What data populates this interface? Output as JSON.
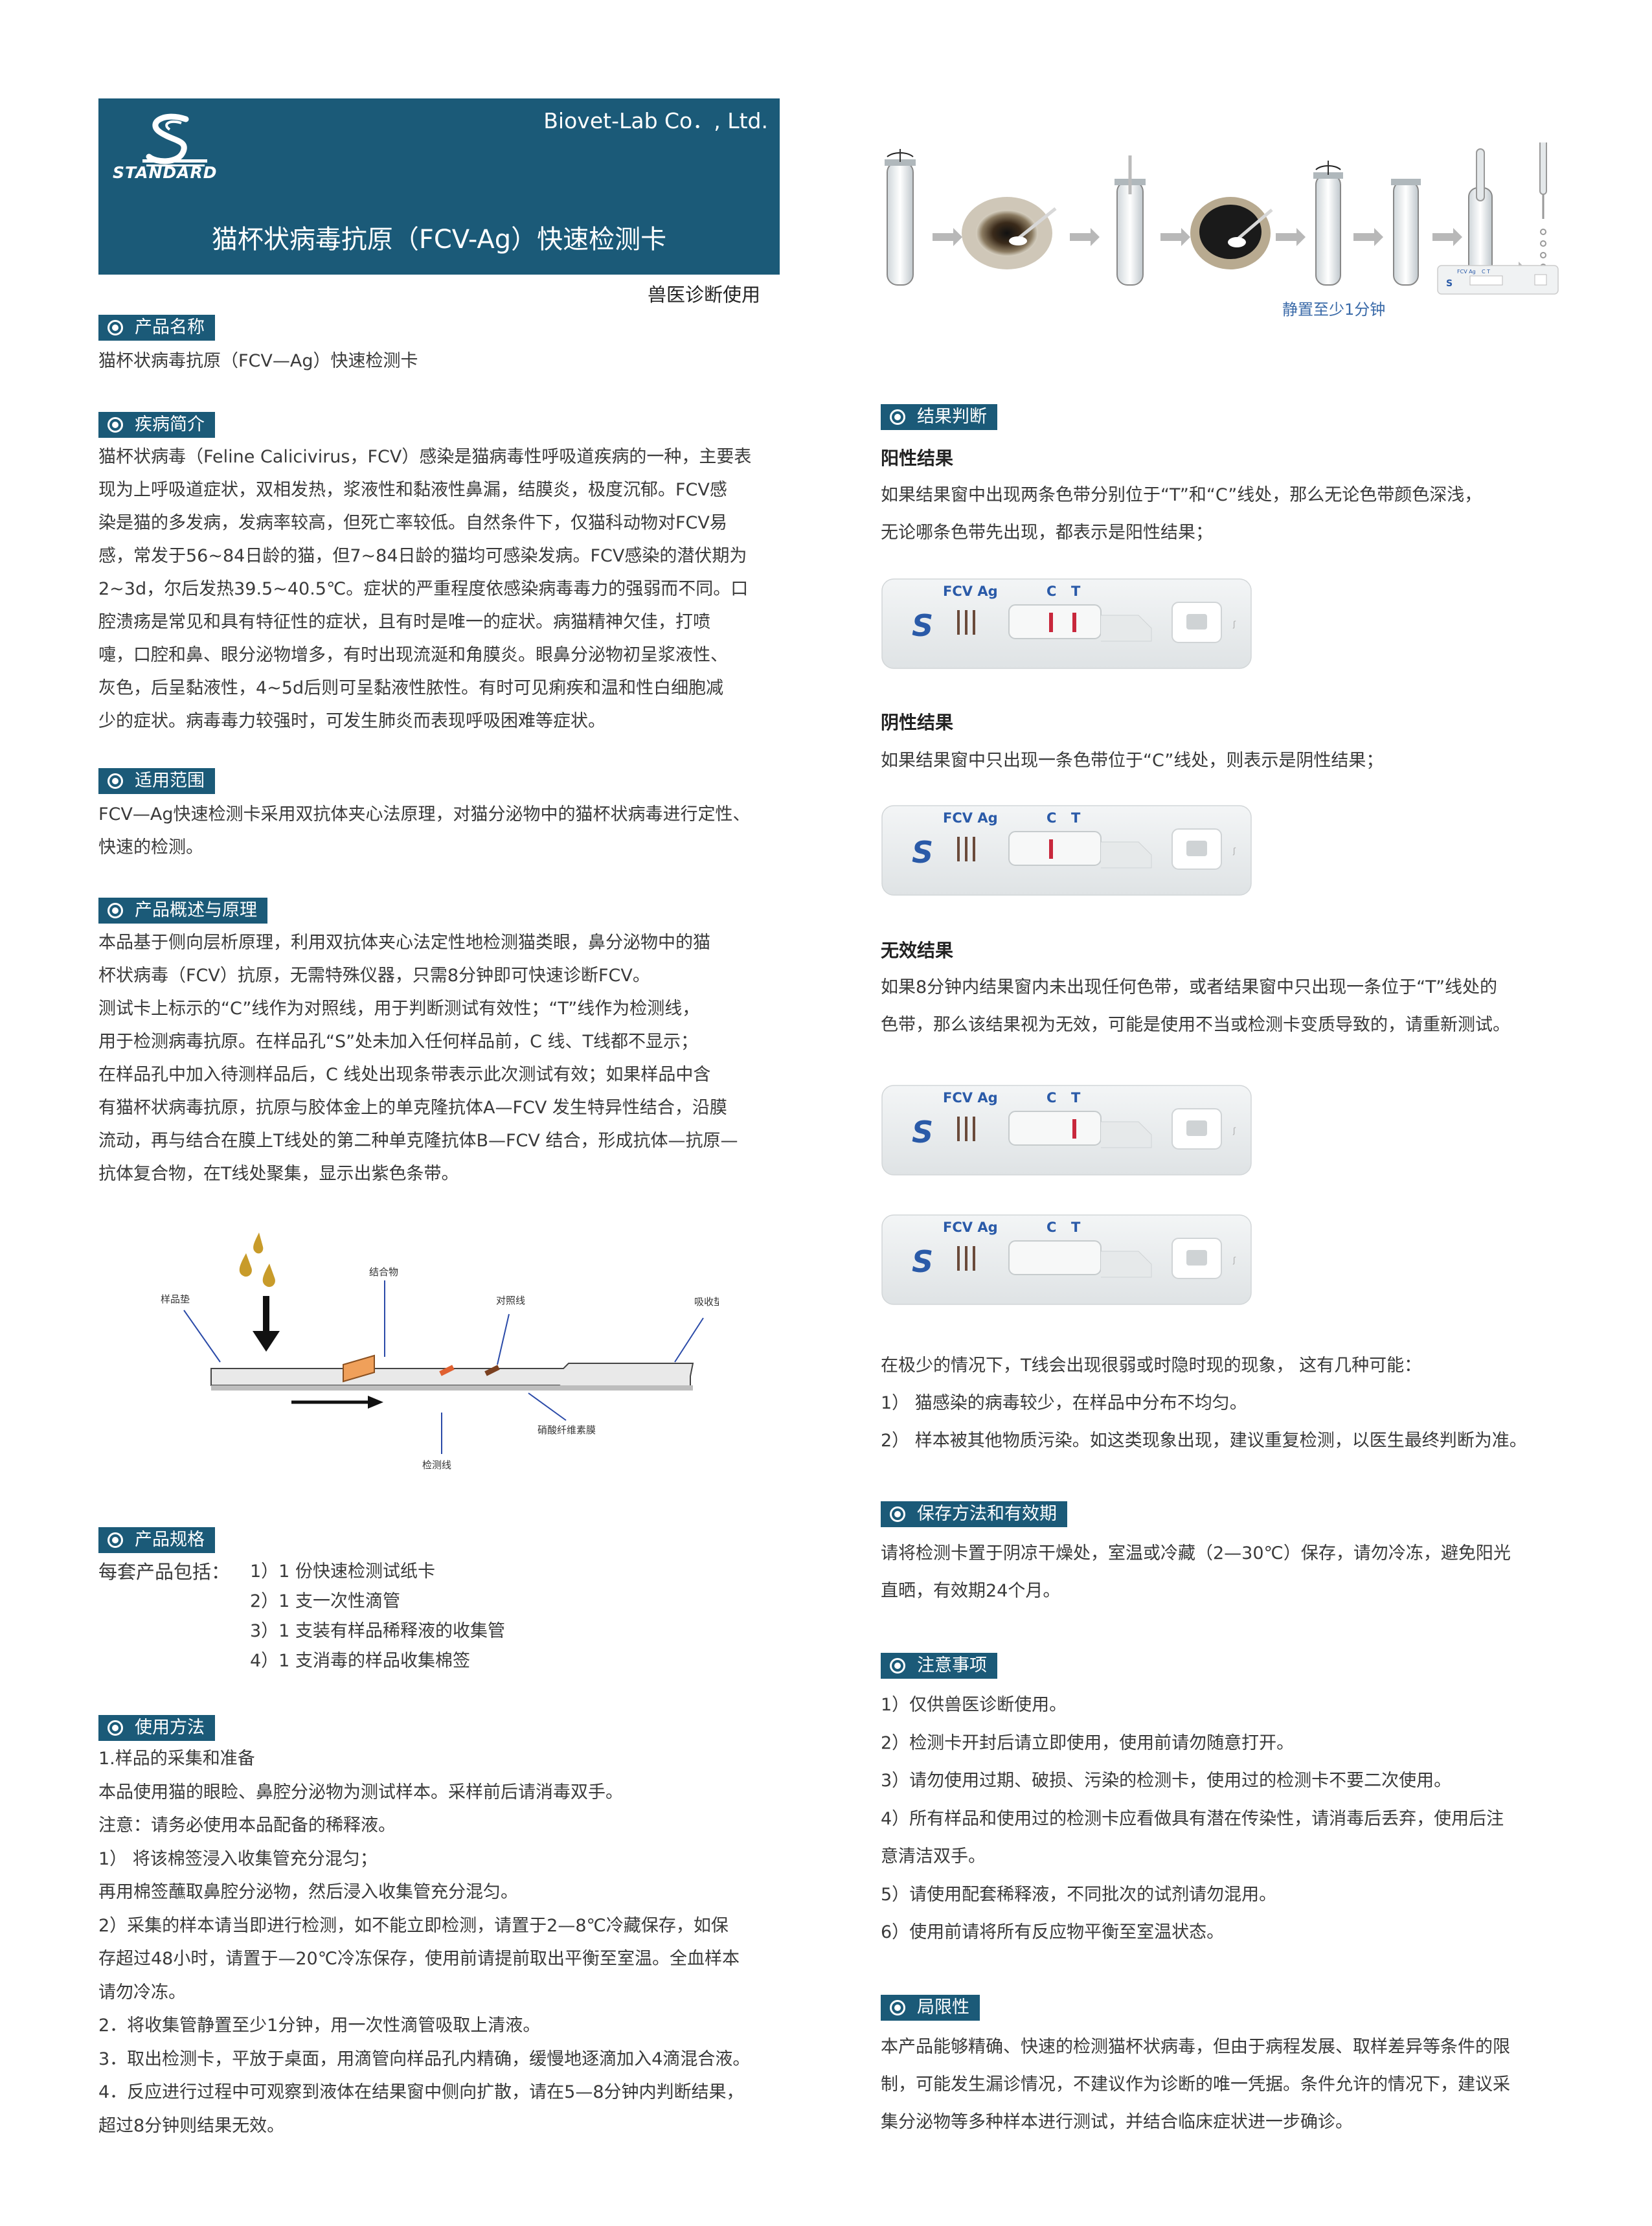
{
  "header": {
    "company": "Biovet-Lab Co．, Ltd.",
    "logo_text": "STANDARD",
    "title": "猫杯状病毒抗原（FCV-Ag）快速检测卡",
    "vet_use": "兽医诊断使用"
  },
  "product_name": {
    "heading": "产品名称",
    "text": "猫杯状病毒抗原（FCV—Ag）快速检测卡"
  },
  "disease": {
    "heading": "疾病简介",
    "lines": [
      "猫杯状病毒（Feline Calicivirus，FCV）感染是猫病毒性呼吸道疾病的一种，主要表",
      "现为上呼吸道症状，双相发热，浆液性和黏液性鼻漏，结膜炎，极度沉郁。FCV感",
      "染是猫的多发病，发病率较高，但死亡率较低。自然条件下，仅猫科动物对FCV易",
      "感，常发于56~84日龄的猫，但7~84日龄的猫均可感染发病。FCV感染的潜伏期为",
      "2~3d，尔后发热39.5~40.5℃。症状的严重程度依感染病毒毒力的强弱而不同。口",
      "腔溃疡是常见和具有特征性的症状，且有时是唯一的症状。病猫精神欠佳，打喷",
      "嚏，口腔和鼻、眼分泌物增多，有时出现流涎和角膜炎。眼鼻分泌物初呈浆液性、",
      "灰色，后呈黏液性，4~5d后则可呈黏液性脓性。有时可见痢疾和温和性白细胞减",
      "少的症状。病毒毒力较强时，可发生肺炎而表现呼吸困难等症状。"
    ]
  },
  "scope": {
    "heading": "适用范围",
    "lines": [
      "FCV—Ag快速检测卡采用双抗体夹心法原理，对猫分泌物中的猫杯状病毒进行定性、",
      "快速的检测。"
    ]
  },
  "principle": {
    "heading": "产品概述与原理",
    "lines": [
      "本品基于侧向层析原理，利用双抗体夹心法定性地检测猫类眼，鼻分泌物中的猫",
      "杯状病毒（FCV）抗原，无需特殊仪器，只需8分钟即可快速诊断FCV。",
      "测试卡上标示的“C”线作为对照线，用于判断测试有效性；“T”线作为检测线，",
      "用于检测病毒抗原。在样品孔“S”处未加入任何样品前，C 线、T线都不显示；",
      "在样品孔中加入待测样品后，C 线处出现条带表示此次测试有效；如果样品中含",
      "有猫杯状病毒抗原，抗原与胶体金上的单克隆抗体A—FCV 发生特异性结合，沿膜",
      "流动，再与结合在膜上T线处的第二种单克隆抗体B—FCV 结合，形成抗体—抗原—",
      "抗体复合物，在T线处聚集，显示出紫色条带。"
    ]
  },
  "diagram_labels": {
    "sample_pad": "样品垫",
    "conjugate": "结合物",
    "control_line": "对照线",
    "absorbent_pad": "吸收垫",
    "test_line": "检测线",
    "nc_membrane": "硝酸纤维素膜"
  },
  "spec": {
    "heading": "产品规格",
    "intro": "每套产品包括：",
    "items": [
      "1）1  份快速检测试纸卡",
      "2）1  支一次性滴管",
      "3）1  支装有样品稀释液的收集管",
      "4）1  支消毒的样品收集棉签"
    ]
  },
  "usage": {
    "heading": "使用方法",
    "lines": [
      "1.样品的采集和准备",
      "本品使用猫的眼睑、鼻腔分泌物为测试样本。采样前后请消毒双手。",
      "注意：请务必使用本品配备的稀释液。",
      "1）   将该棉签浸入收集管充分混匀；",
      "再用棉签蘸取鼻腔分泌物，然后浸入收集管充分混匀。",
      "2）采集的样本请当即进行检测，如不能立即检测，请置于2—8℃冷藏保存，如保",
      "存超过48小时，请置于—20℃冷冻保存，使用前请提前取出平衡至室温。全血样本",
      "请勿冷冻。",
      "2．将收集管静置至少1分钟，用一次性滴管吸取上清液。",
      "3．取出检测卡，平放于桌面，用滴管向样品孔内精确，缓慢地逐滴加入4滴混合液。",
      "4．反应进行过程中可观察到液体在结果窗中侧向扩散，请在5—8分钟内判断结果，",
      "超过8分钟则结果无效。"
    ]
  },
  "procedure": {
    "caption": "静置至少1分钟",
    "card_label": "FCV Ag",
    "card_ct": "C  T"
  },
  "result": {
    "heading": "结果判断",
    "positive_title": "阳性结果",
    "positive_lines": [
      "如果结果窗中出现两条色带分别位于“T”和“C”线处，那么无论色带颜色深浅，",
      "无论哪条色带先出现，都表示是阳性结果；"
    ],
    "negative_title": "阴性结果",
    "negative_lines": [
      "如果结果窗中只出现一条色带位于“C”线处，则表示是阴性结果；"
    ],
    "invalid_title": "无效结果",
    "invalid_lines": [
      "如果8分钟内结果窗内未出现任何色带，或者结果窗中只出现一条位于“T”线处的",
      "色带，那么该结果视为无效，可能是使用不当或检测卡变质导致的，请重新测试。"
    ],
    "card_label": "FCV Ag",
    "card_c": "C",
    "card_t": "T",
    "weak_lines": [
      "在极少的情况下，T线会出现很弱或时隐时现的现象，   这有几种可能：",
      "1）  猫感染的病毒较少，在样品中分布不均匀。",
      "2）  样本被其他物质污染。如这类现象出现，建议重复检测，以医生最终判断为准。"
    ]
  },
  "storage": {
    "heading": "保存方法和有效期",
    "lines": [
      "请将检测卡置于阴凉干燥处，室温或冷藏（2—30℃）保存，请勿冷冻，避免阳光",
      "直晒，有效期24个月。"
    ]
  },
  "notes": {
    "heading": "注意事项",
    "lines": [
      "1）仅供兽医诊断使用。",
      "2）检测卡开封后请立即使用，使用前请勿随意打开。",
      "3）请勿使用过期、破损、污染的检测卡，使用过的检测卡不要二次使用。",
      "4）所有样品和使用过的检测卡应看做具有潜在传染性，请消毒后丢弃，使用后注",
      "意清洁双手。",
      "5）请使用配套稀释液，不同批次的试剂请勿混用。",
      "6）使用前请将所有反应物平衡至室温状态。"
    ]
  },
  "limits": {
    "heading": "局限性",
    "lines": [
      "本产品能够精确、快速的检测猫杯状病毒，但由于病程发展、取样差异等条件的限",
      "制，可能发生漏诊情况，不建议作为诊断的唯一凭据。条件允许的情况下，建议采",
      "集分泌物等多种样本进行测试，并结合临床症状进一步确诊。"
    ]
  },
  "colors": {
    "header_blue": "#1b5a78",
    "band_red": "#c8283c",
    "logo_blue": "#2a5aa8"
  }
}
